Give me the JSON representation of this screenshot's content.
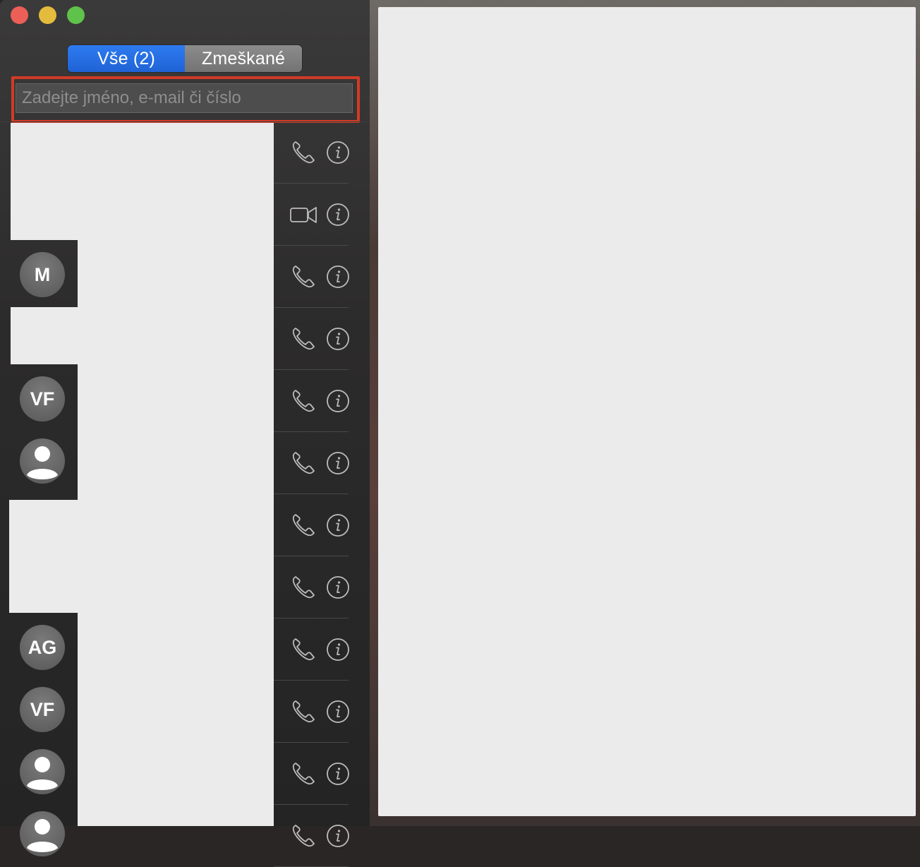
{
  "window": {
    "close_button": "close",
    "minimize_button": "minimize",
    "zoom_button": "zoom"
  },
  "tabs": {
    "all_label": "Vše (2)",
    "missed_label": "Zmeškané",
    "selected": "all"
  },
  "search": {
    "placeholder": "Zadejte jméno, e-mail či číslo",
    "value": ""
  },
  "avatars": [
    {
      "initials": "M",
      "type": "initials"
    },
    {
      "initials": "VF",
      "type": "initials"
    },
    {
      "initials": "",
      "type": "person-icon"
    },
    {
      "initials": "AG",
      "type": "initials"
    },
    {
      "initials": "VF",
      "type": "initials"
    },
    {
      "initials": "",
      "type": "person-icon"
    }
  ],
  "calls": [
    {
      "kind": "phone-icon"
    },
    {
      "kind": "video-camera-icon"
    },
    {
      "kind": "phone-icon"
    },
    {
      "kind": "phone-icon"
    },
    {
      "kind": "phone-icon"
    },
    {
      "kind": "phone-icon"
    },
    {
      "kind": "phone-icon"
    },
    {
      "kind": "phone-icon"
    },
    {
      "kind": "phone-icon"
    },
    {
      "kind": "phone-icon"
    },
    {
      "kind": "phone-icon"
    },
    {
      "kind": "phone-icon"
    }
  ],
  "colors": {
    "accent": "#2e7bf0",
    "highlight_border": "#d13b26"
  }
}
